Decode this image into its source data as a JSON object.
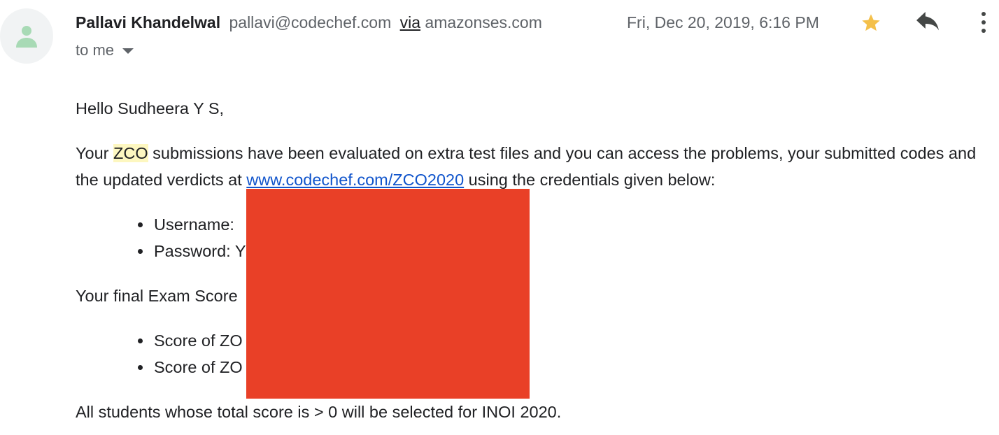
{
  "header": {
    "sender_name": "Pallavi Khandelwal",
    "sender_email": "pallavi@codechef.com",
    "via_label": "via",
    "via_domain": "amazonses.com",
    "recipient": "to me",
    "date": "Fri, Dec 20, 2019, 6:16 PM",
    "star_color": "#f4c04a",
    "icons": {
      "avatar": "person-icon",
      "star": "star-icon",
      "reply": "reply-icon",
      "more": "more-vert-icon",
      "recipient_caret": "caret-down-icon"
    }
  },
  "body": {
    "greeting": "Hello Sudheera Y S,",
    "p1_before": "Your ",
    "p1_highlight": "ZCO",
    "p1_middle": " submissions have been evaluated on extra test files and you can access the problems, your submitted codes and the updated verdicts at ",
    "p1_link": "www.codechef.com/ZCO2020",
    "p1_after": " using the credentials given below:",
    "credentials": [
      "Username:",
      "Password: Y"
    ],
    "score_intro": "Your final Exam Score",
    "scores": [
      "Score of ZO",
      "Score of ZO"
    ],
    "closing": "All students whose total score is > 0 will be selected for INOI 2020."
  },
  "colors": {
    "redaction": "#e94027",
    "link": "#1155cc",
    "highlight": "#fdf7c0"
  }
}
